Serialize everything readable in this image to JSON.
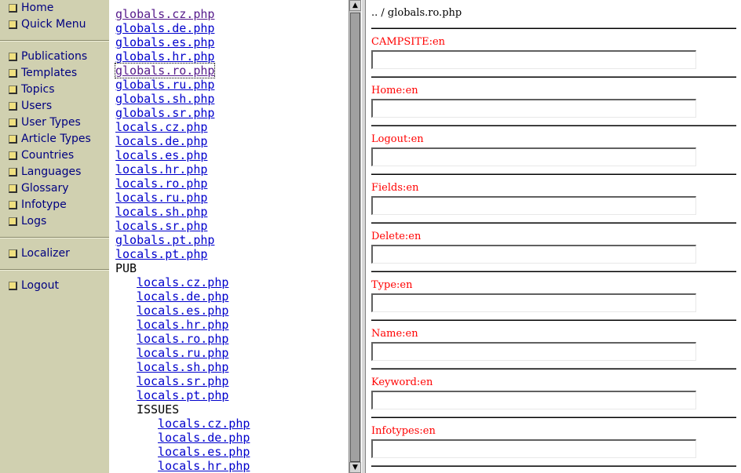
{
  "nav": {
    "groups": [
      [
        "Home",
        "Quick Menu"
      ],
      [
        "Publications",
        "Templates",
        "Topics",
        "Users",
        "User Types",
        "Article Types",
        "Countries",
        "Languages",
        "Glossary",
        "Infotype",
        "Logs"
      ],
      [
        "Localizer"
      ],
      [
        "Logout"
      ]
    ]
  },
  "tree": [
    {
      "text": "globals.cz.php",
      "indent": 0,
      "link": true,
      "visited": true
    },
    {
      "text": "globals.de.php",
      "indent": 0,
      "link": true
    },
    {
      "text": "globals.es.php",
      "indent": 0,
      "link": true
    },
    {
      "text": "globals.hr.php",
      "indent": 0,
      "link": true
    },
    {
      "text": "globals.ro.php",
      "indent": 0,
      "link": true,
      "visited": true,
      "focused": true
    },
    {
      "text": "globals.ru.php",
      "indent": 0,
      "link": true
    },
    {
      "text": "globals.sh.php",
      "indent": 0,
      "link": true
    },
    {
      "text": "globals.sr.php",
      "indent": 0,
      "link": true
    },
    {
      "text": "locals.cz.php",
      "indent": 0,
      "link": true
    },
    {
      "text": "locals.de.php",
      "indent": 0,
      "link": true
    },
    {
      "text": "locals.es.php",
      "indent": 0,
      "link": true
    },
    {
      "text": "locals.hr.php",
      "indent": 0,
      "link": true
    },
    {
      "text": "locals.ro.php",
      "indent": 0,
      "link": true
    },
    {
      "text": "locals.ru.php",
      "indent": 0,
      "link": true
    },
    {
      "text": "locals.sh.php",
      "indent": 0,
      "link": true
    },
    {
      "text": "locals.sr.php",
      "indent": 0,
      "link": true
    },
    {
      "text": "globals.pt.php",
      "indent": 0,
      "link": true
    },
    {
      "text": "locals.pt.php",
      "indent": 0,
      "link": true
    },
    {
      "text": "PUB",
      "indent": 0,
      "link": false
    },
    {
      "text": "locals.cz.php",
      "indent": 1,
      "link": true
    },
    {
      "text": "locals.de.php",
      "indent": 1,
      "link": true
    },
    {
      "text": "locals.es.php",
      "indent": 1,
      "link": true
    },
    {
      "text": "locals.hr.php",
      "indent": 1,
      "link": true
    },
    {
      "text": "locals.ro.php",
      "indent": 1,
      "link": true
    },
    {
      "text": "locals.ru.php",
      "indent": 1,
      "link": true
    },
    {
      "text": "locals.sh.php",
      "indent": 1,
      "link": true
    },
    {
      "text": "locals.sr.php",
      "indent": 1,
      "link": true
    },
    {
      "text": "locals.pt.php",
      "indent": 1,
      "link": true
    },
    {
      "text": "ISSUES",
      "indent": 1,
      "link": false
    },
    {
      "text": "locals.cz.php",
      "indent": 2,
      "link": true
    },
    {
      "text": "locals.de.php",
      "indent": 2,
      "link": true
    },
    {
      "text": "locals.es.php",
      "indent": 2,
      "link": true
    },
    {
      "text": "locals.hr.php",
      "indent": 2,
      "link": true
    }
  ],
  "scrollbar": {
    "up_glyph": "▲",
    "down_glyph": "▼"
  },
  "editor": {
    "breadcrumb": ".. / globals.ro.php",
    "label_color": "#ff0000",
    "fields": [
      {
        "label": "CAMPSITE:en",
        "value": ""
      },
      {
        "label": "Home:en",
        "value": ""
      },
      {
        "label": "Logout:en",
        "value": ""
      },
      {
        "label": "Fields:en",
        "value": ""
      },
      {
        "label": "Delete:en",
        "value": ""
      },
      {
        "label": "Type:en",
        "value": ""
      },
      {
        "label": "Name:en",
        "value": ""
      },
      {
        "label": "Keyword:en",
        "value": ""
      },
      {
        "label": "Infotypes:en",
        "value": ""
      }
    ]
  }
}
